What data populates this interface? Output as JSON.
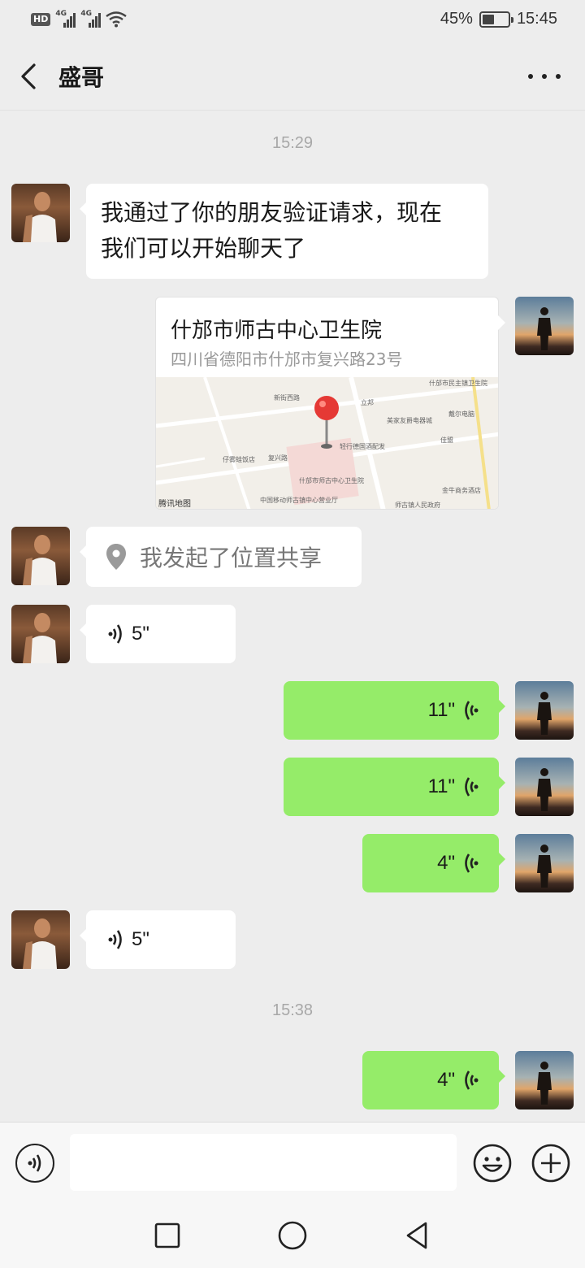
{
  "status_bar": {
    "hd": "HD",
    "sim1": "4G",
    "sim2": "4G",
    "battery_percent": "45%",
    "battery_level": 0.45,
    "time": "15:45"
  },
  "header": {
    "title": "盛哥",
    "back_icon": "chevron-left-icon",
    "more_icon": "more-dots-icon"
  },
  "messages": {
    "time1": "15:29",
    "m1_text_line1": "我通过了你的朋友验证请求，现在",
    "m1_text_line2": "我们可以开始聊天了",
    "location": {
      "title": "什邡市师古中心卫生院",
      "address": "四川省德阳市什邡市复兴路23号",
      "map_credit": "腾讯地图",
      "map_labels": [
        "新街西路",
        "复兴路",
        "什邡市民主镇卫生院",
        "立邦",
        "戴尔电脑",
        "美家友爵电器城",
        "轻行德国酒配发",
        "佳盟",
        "仔雾蛙饭店",
        "什邡市师古中心卫生院",
        "中国移动师古镇中心营业厅",
        "金牛商务酒店",
        "师古镇人民政府"
      ]
    },
    "m3_text": "我发起了位置共享",
    "m4_duration": "5\"",
    "m5_duration": "11\"",
    "m6_duration": "11\"",
    "m7_duration": "4\"",
    "m8_duration": "5\"",
    "time2": "15:38",
    "m9_duration": "4\""
  },
  "input_bar": {
    "value": "",
    "voice_icon": "voice-mode-icon",
    "emoji_icon": "emoji-icon",
    "plus_icon": "plus-icon"
  },
  "nav_bar": {
    "recent_icon": "square-icon",
    "home_icon": "circle-icon",
    "back_icon": "triangle-back-icon"
  },
  "colors": {
    "background": "#ededed",
    "outgoing_bubble": "#95ec69",
    "incoming_bubble": "#ffffff",
    "timestamp": "#a8a8a8",
    "map_pin": "#e53935"
  }
}
